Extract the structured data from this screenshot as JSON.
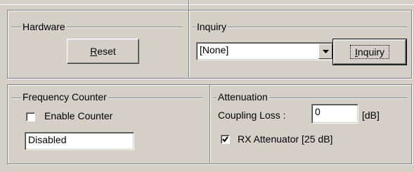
{
  "hardware": {
    "group_label": "Hardware",
    "reset_accel": "R",
    "reset_rest": "eset"
  },
  "inquiry": {
    "group_label": "Inquiry",
    "select_value": "[None]",
    "button_accel": "I",
    "button_rest": "nquiry"
  },
  "frequency_counter": {
    "group_label": "Frequency Counter",
    "enable_label": "Enable Counter",
    "enable_checked": false,
    "status_value": "Disabled"
  },
  "attenuation": {
    "group_label": "Attenuation",
    "coupling_label": "Coupling Loss :",
    "coupling_value": "0",
    "coupling_unit": "[dB]",
    "rx_label": "RX Attenuator [25 dB]",
    "rx_checked": true
  }
}
